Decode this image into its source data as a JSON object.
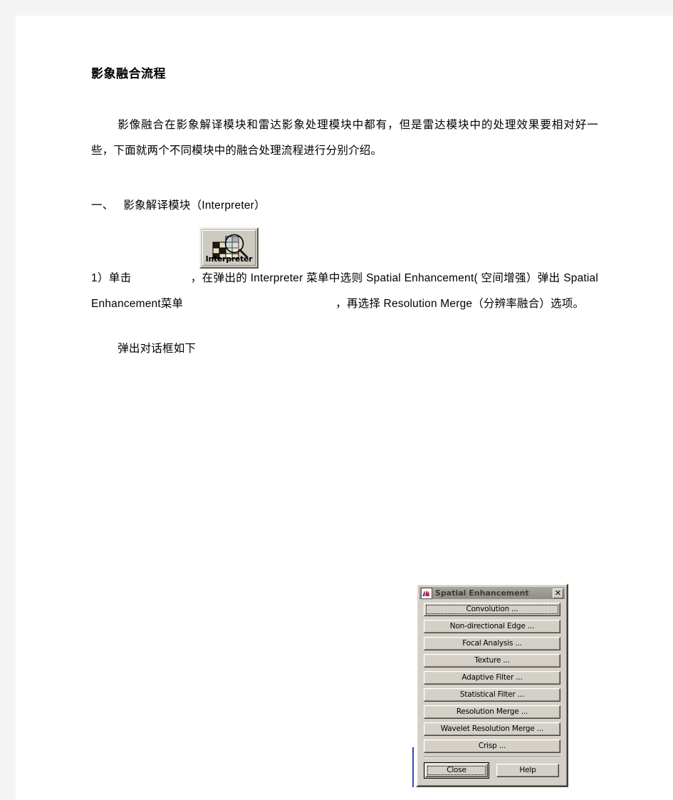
{
  "document": {
    "title": "影象融合流程",
    "intro_paragraph": "影像融合在影象解译模块和雷达影象处理模块中都有，但是雷达模块中的处理效果要相对好一些，下面就两个不同模块中的融合处理流程进行分别介绍。",
    "section_number": "一、",
    "section_title": "影象解译模块（Interpreter）",
    "step1_prefix": "1）单击",
    "step1_middle": "，在弹出的 Interpreter 菜单中选则 Spatial  Enhancement( 空间增强）弹出 Spatial  Enhancement菜单",
    "step1_suffix": "，再选择 Resolution Merge（分辨率融合）选项。",
    "closing_line": "弹出对话框如下"
  },
  "interpreter_button": {
    "label": "Interpreter",
    "icon": "magnifier-over-raster-grid-icon"
  },
  "dialog": {
    "title": "Spatial Enhancement",
    "title_icon": "erdas-imagine-app-icon",
    "close_label": "✕",
    "buttons": [
      {
        "label": "Convolution ...",
        "focused": true
      },
      {
        "label": "Non-directional Edge ...",
        "focused": false
      },
      {
        "label": "Focal Analysis ...",
        "focused": false
      },
      {
        "label": "Texture ...",
        "focused": false
      },
      {
        "label": "Adaptive Filter ...",
        "focused": false
      },
      {
        "label": "Statistical Filter ...",
        "focused": false
      },
      {
        "label": "Resolution Merge ...",
        "focused": false
      },
      {
        "label": "Wavelet Resolution Merge ...",
        "focused": false
      },
      {
        "label": "Crisp ...",
        "focused": false
      }
    ],
    "footer": {
      "close_label": "Close",
      "help_label": "Help"
    }
  },
  "colors": {
    "page_background": "#f4f4f4",
    "page": "#ffffff",
    "dialog_face": "#d4d0c8",
    "titlebar": "#9a988f",
    "button_face": "#cdcabf",
    "text": "#000000"
  }
}
